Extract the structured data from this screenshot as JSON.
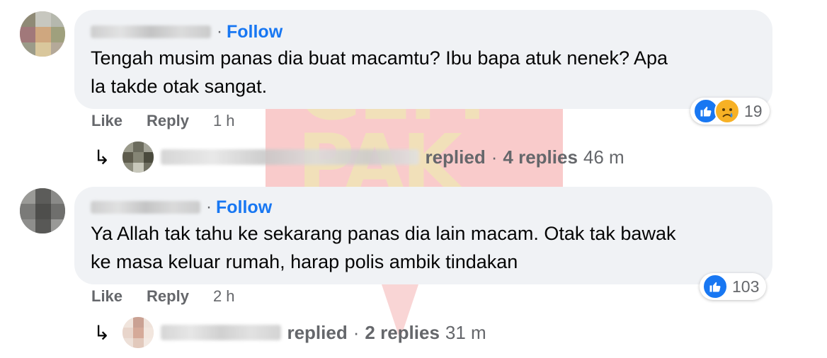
{
  "comments": [
    {
      "follow_label": "Follow",
      "text_lines": [
        "Tengah musim panas dia buat macamtu? Ibu bapa atuk nenek? Apa",
        "la takde otak sangat."
      ],
      "actions": {
        "like": "Like",
        "reply": "Reply",
        "time": "1 h"
      },
      "reaction_count": "19",
      "reply_summary": {
        "replied": "replied",
        "sep": "·",
        "count": "4 replies",
        "time": "46 m"
      }
    },
    {
      "follow_label": "Follow",
      "text_lines": [
        "Ya Allah tak tahu ke sekarang panas dia lain macam. Otak tak bawak",
        "ke masa keluar rumah, harap polis ambik tindakan"
      ],
      "actions": {
        "like": "Like",
        "reply": "Reply",
        "time": "2 h"
      },
      "reaction_count": "103",
      "reply_summary": {
        "replied": "replied",
        "sep": "·",
        "count": "2 replies",
        "time": "31 m"
      }
    }
  ],
  "watermark_text": [
    "GEM",
    "PAK"
  ],
  "colors": {
    "bubble": "#f0f2f5",
    "follow": "#1877f2",
    "muted": "#65676b",
    "like": "#1877f2",
    "sad": "#f7b125"
  },
  "icons": {
    "separator": "·",
    "reply_arrow": "↳",
    "like": "like-icon",
    "sad": "sad-icon"
  }
}
